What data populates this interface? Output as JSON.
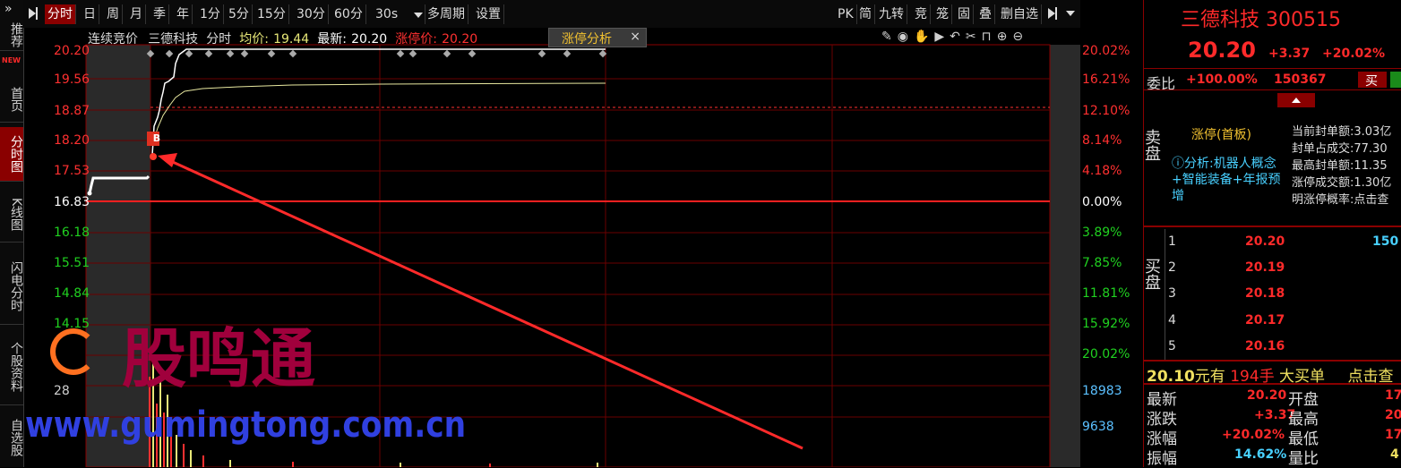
{
  "sidebar": {
    "expand": "»",
    "items": [
      "推荐",
      "首页",
      "分时图",
      "K线图",
      "闪电分时",
      "个股资料",
      "自选股"
    ],
    "new_badge": "NEW"
  },
  "toolbar": {
    "left": [
      "分时",
      "日",
      "周",
      "月",
      "季",
      "年",
      "1分",
      "5分",
      "15分",
      "30分",
      "60分",
      "30s",
      "多周期",
      "设置"
    ],
    "right": [
      "PK",
      "简",
      "九转",
      "竞",
      "笼",
      "固",
      "叠",
      "删自选"
    ]
  },
  "info": {
    "mode": "连续竞价",
    "name": "三德科技",
    "period": "分时",
    "avg_label": "均价:",
    "avg_value": "19.44",
    "latest_label": "最新:",
    "latest_value": "20.20",
    "limit_label": "涨停价:",
    "limit_value": "20.20",
    "tab": "涨停分析",
    "tab_close": "×"
  },
  "axis": {
    "left": [
      "20.20",
      "19.56",
      "18.87",
      "18.20",
      "17.53",
      "16.83",
      "16.18",
      "15.51",
      "14.84",
      "14.15",
      "",
      "28"
    ],
    "right": [
      "20.02%",
      "16.21%",
      "12.10%",
      "8.14%",
      "4.18%",
      "0.00%",
      "3.89%",
      "7.85%",
      "11.81%",
      "15.92%",
      "20.02%",
      "18983",
      "9638"
    ]
  },
  "marker": "B",
  "watermark": {
    "text": "股鸣通",
    "url": "www.gumingtong.com.cn"
  },
  "quote": {
    "title": "三德科技 300515",
    "price": "20.20",
    "change": "+3.37",
    "change_pct": "+20.02%",
    "wb_label": "委比",
    "wb_pct": "+100.00%",
    "wb_vol": "150367",
    "buy_button": "买",
    "sell_side": "卖盘",
    "status": "涨停(首板)",
    "analysis": "ⓘ分析:机器人概念+智能装备+年报预增",
    "seal_lines": [
      "当前封单额:3.03亿",
      "封单占成交:77.30",
      "最高封单额:11.35",
      "涨停成交额:1.30亿",
      "明涨停概率:点击查"
    ],
    "buy_side": "买盘",
    "buy_levels": [
      {
        "level": "1",
        "price": "20.20",
        "vol": "150"
      },
      {
        "level": "2",
        "price": "20.19",
        "vol": ""
      },
      {
        "level": "3",
        "price": "20.18",
        "vol": ""
      },
      {
        "level": "4",
        "price": "20.17",
        "vol": ""
      },
      {
        "level": "5",
        "price": "20.16",
        "vol": ""
      }
    ],
    "bigorder": {
      "price": "20.10",
      "text1": "元有",
      "qty": "194手",
      "text2": "大买单",
      "link": "点击查"
    },
    "stats": [
      {
        "k1": "最新",
        "v1": "20.20",
        "k2": "开盘",
        "v2": "17"
      },
      {
        "k1": "涨跌",
        "v1": "+3.37",
        "k2": "最高",
        "v2": "20"
      },
      {
        "k1": "涨幅",
        "v1": "+20.02%",
        "k2": "最低",
        "v2": "17"
      },
      {
        "k1": "振幅",
        "v1": "14.62%",
        "k2": "量比",
        "v2": "4"
      }
    ]
  }
}
